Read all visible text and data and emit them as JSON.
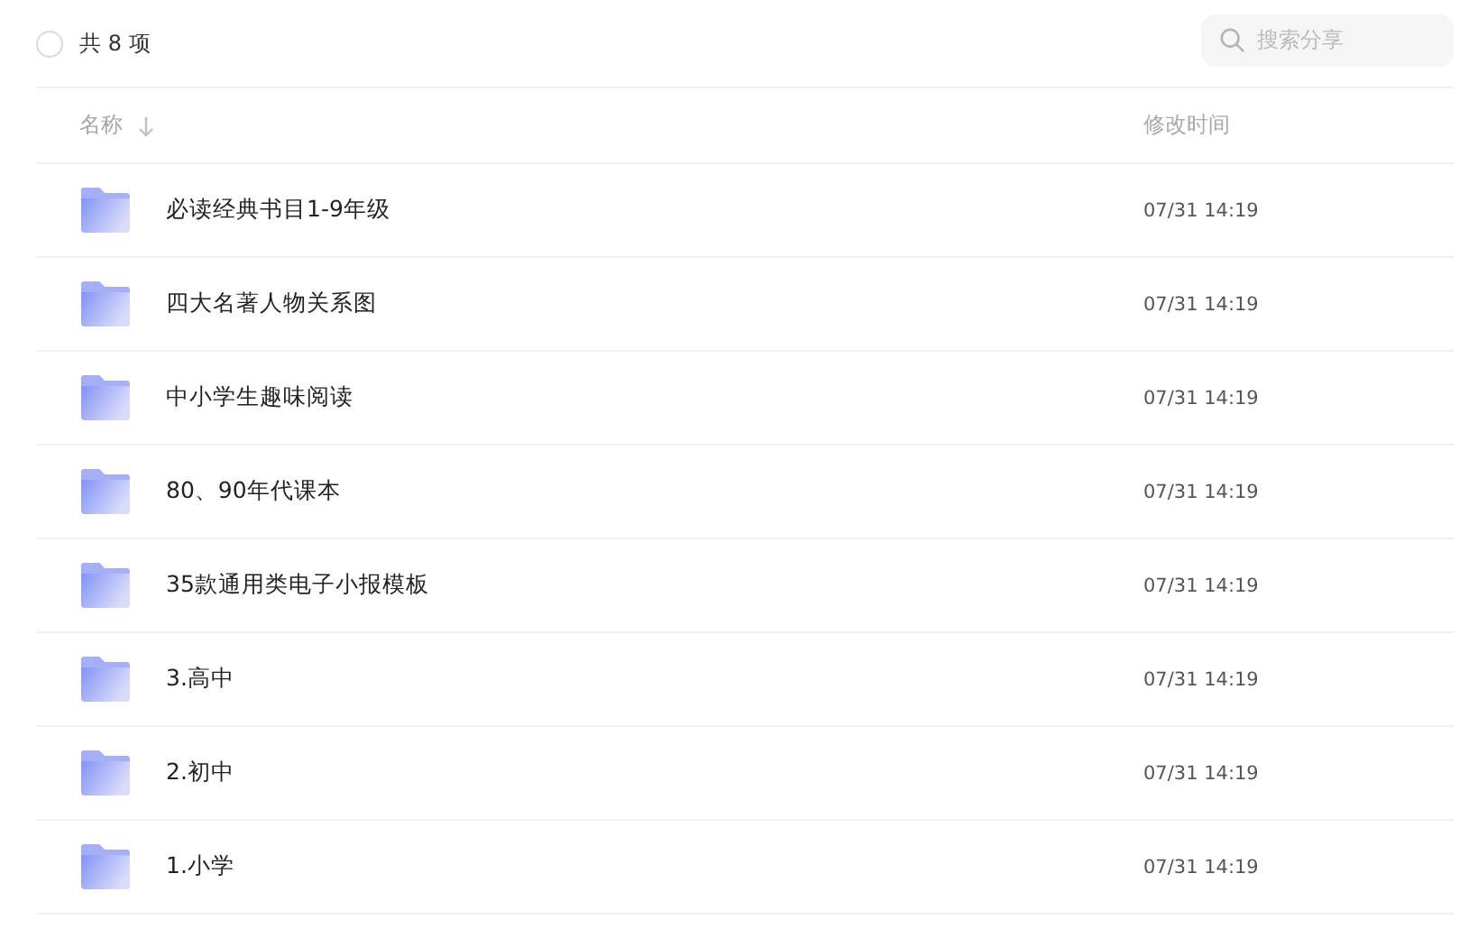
{
  "header": {
    "select_all": {
      "checked": false
    },
    "count": "共 8 项",
    "search": {
      "placeholder": "搜索分享"
    }
  },
  "table": {
    "columns": [
      {
        "label": "名称",
        "sorted": true
      },
      {
        "label": "修改时间",
        "sorted": false
      }
    ],
    "rows": [
      {
        "name": "必读经典书目1-9年级",
        "modified": "07/31 14:19"
      },
      {
        "name": "四大名著人物关系图",
        "modified": "07/31 14:19"
      },
      {
        "name": "中小学生趣味阅读",
        "modified": "07/31 14:19"
      },
      {
        "name": "80、90年代课本",
        "modified": "07/31 14:19"
      },
      {
        "name": "35款通用类电子小报模板",
        "modified": "07/31 14:19"
      },
      {
        "name": "3.高中",
        "modified": "07/31 14:19"
      },
      {
        "name": "2.初中",
        "modified": "07/31 14:19"
      },
      {
        "name": "1.小学",
        "modified": "07/31 14:19"
      }
    ]
  }
}
